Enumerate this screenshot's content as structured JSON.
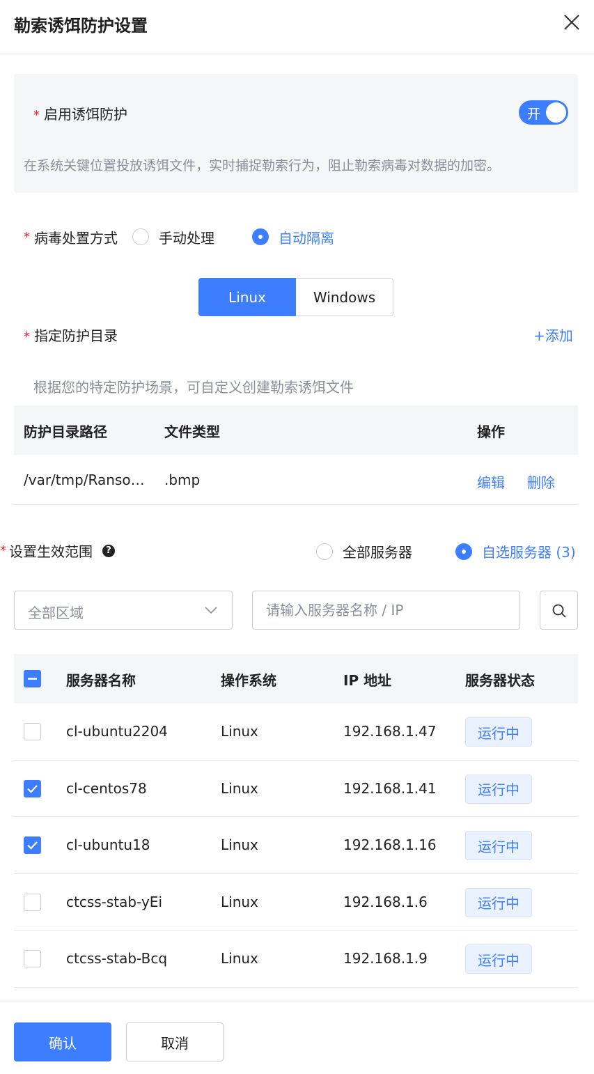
{
  "dialog": {
    "title": "勒索诱饵防护设置",
    "close_icon": "close-icon"
  },
  "enable": {
    "required_mark": "*",
    "label": "启用诱饵防护",
    "switch_text": "开",
    "switch_on": true,
    "description": "在系统关键位置投放诱饵文件，实时捕捉勒索行为，阻止勒索病毒对数据的加密。"
  },
  "virus": {
    "required_mark": "*",
    "label": "病毒处置方式",
    "options": [
      {
        "label": "手动处理",
        "selected": false
      },
      {
        "label": "自动隔离",
        "selected": true
      }
    ]
  },
  "os_tabs": [
    {
      "label": "Linux",
      "active": true
    },
    {
      "label": "Windows",
      "active": false
    }
  ],
  "directory": {
    "required_mark": "*",
    "label": "指定防护目录",
    "add_label": "+添加",
    "hint": "根据您的特定防护场景，可自定义创建勒索诱饵文件",
    "columns": {
      "path": "防护目录路径",
      "type": "文件类型",
      "action": "操作"
    },
    "rows": [
      {
        "path": "/var/tmp/Ranso…",
        "type": ".bmp",
        "edit": "编辑",
        "delete": "删除"
      }
    ]
  },
  "scope": {
    "required_mark": "*",
    "label": "设置生效范围",
    "help_icon": "question-circle-icon",
    "help_glyph": "?",
    "options": [
      {
        "label": "全部服务器",
        "selected": false
      },
      {
        "label": "自选服务器 (3)",
        "selected": true
      }
    ]
  },
  "filters": {
    "region_value": "全部区域",
    "region_icon": "chevron-down-icon",
    "search_placeholder": "请输入服务器名称 / IP",
    "search_icon": "search-icon"
  },
  "servers": {
    "columns": {
      "name": "服务器名称",
      "os": "操作系统",
      "ip": "IP 地址",
      "status": "服务器状态"
    },
    "header_checkbox": "indeterminate",
    "rows": [
      {
        "checked": false,
        "name": "cl-ubuntu2204",
        "os": "Linux",
        "ip": "192.168.1.47",
        "status": "运行中"
      },
      {
        "checked": true,
        "name": "cl-centos78",
        "os": "Linux",
        "ip": "192.168.1.41",
        "status": "运行中"
      },
      {
        "checked": true,
        "name": "cl-ubuntu18",
        "os": "Linux",
        "ip": "192.168.1.16",
        "status": "运行中"
      },
      {
        "checked": false,
        "name": "ctcss-stab-yEi",
        "os": "Linux",
        "ip": "192.168.1.6",
        "status": "运行中"
      },
      {
        "checked": false,
        "name": "ctcss-stab-Bcq",
        "os": "Linux",
        "ip": "192.168.1.9",
        "status": "运行中"
      }
    ]
  },
  "footer": {
    "confirm_label": "确认",
    "cancel_label": "取消"
  },
  "colors": {
    "accent": "#3d7dff",
    "required": "#f5222d",
    "muted_text": "#8a8f99",
    "panel_bg": "#f5f6f8"
  }
}
